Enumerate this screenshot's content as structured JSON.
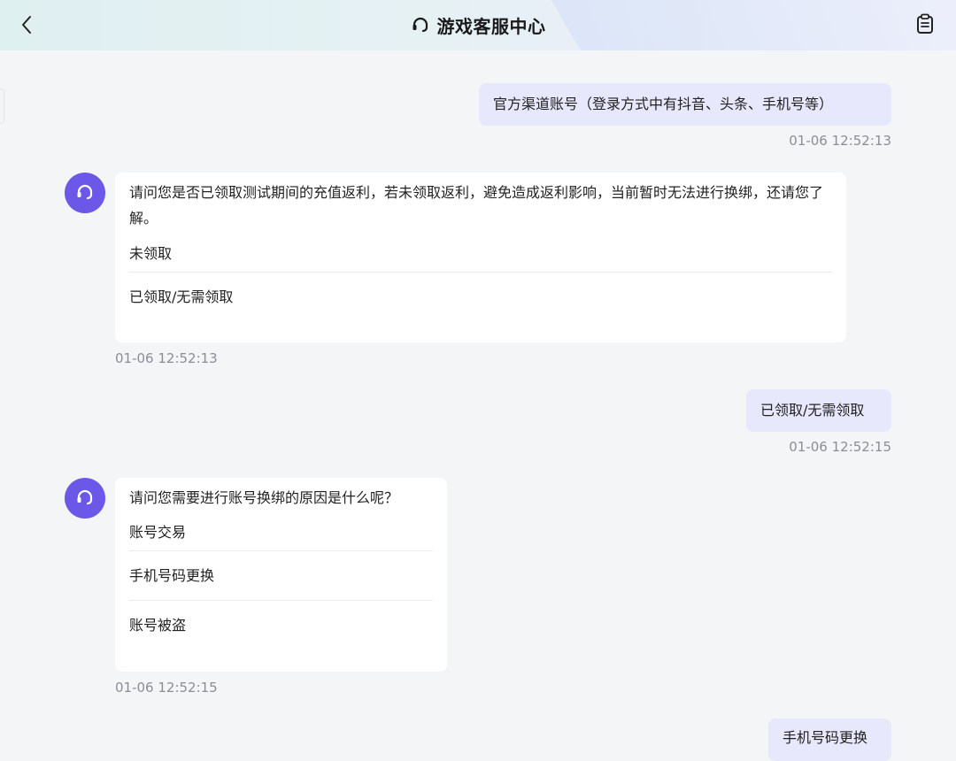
{
  "header": {
    "title": "游戏客服中心",
    "icons": {
      "back": "chevron-left-icon",
      "support": "headset-icon",
      "records": "clipboard-icon"
    }
  },
  "messages": [
    {
      "role": "user",
      "text": "官方渠道账号（登录方式中有抖音、头条、手机号等）",
      "time": "01-06 12:52:13"
    },
    {
      "role": "bot",
      "text": "请问您是否已领取测试期间的充值返利，若未领取返利，避免造成返利影响，当前暂时无法进行换绑，还请您了解。",
      "options": [
        "未领取",
        "已领取/无需领取"
      ],
      "time": "01-06 12:52:13"
    },
    {
      "role": "user",
      "text": "已领取/无需领取",
      "time": "01-06 12:52:15"
    },
    {
      "role": "bot",
      "text": "请问您需要进行账号换绑的原因是什么呢？",
      "options": [
        "账号交易",
        "手机号码更换",
        "账号被盗"
      ],
      "time": "01-06 12:52:15"
    },
    {
      "role": "user",
      "text": "手机号码更换"
    }
  ],
  "colors": {
    "accent": "#6b57e8",
    "user_bubble": "#e7e8fb",
    "bot_bubble": "#ffffff",
    "background": "#f4f5f7",
    "timestamp": "#8b8e96"
  }
}
